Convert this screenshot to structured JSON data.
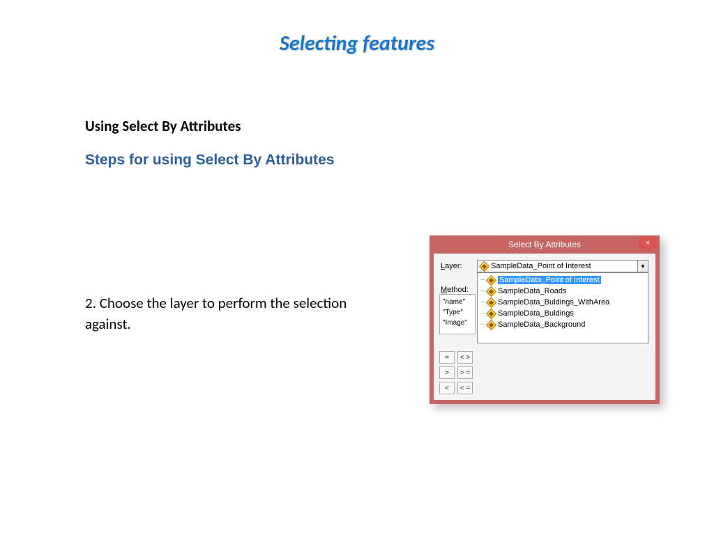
{
  "title": "Selecting features",
  "section1": "Using Select By Attributes",
  "section2": "Steps for using Select By Attributes",
  "step_text": "2. Choose the layer to perform the selection against.",
  "dialog": {
    "title": "Select By Attributes",
    "close_glyph": "×",
    "layer_label_pre": "L",
    "layer_label_rest": "ayer:",
    "method_label_pre": "M",
    "method_label_rest": "ethod:",
    "selected_layer": "SampleData_Point of Interest",
    "dropdown_arrow": "▼",
    "layers": [
      "SampleData_Point of Interest",
      "SampleData_Roads",
      "SampleData_Buldings_WithArea",
      "SampleData_Buldings",
      "SampleData_Background"
    ],
    "fields": [
      "\"name\"",
      "\"Type\"",
      "\"Image\""
    ],
    "ops": [
      [
        "=",
        "< >"
      ],
      [
        ">",
        "> ="
      ],
      [
        "<",
        "< ="
      ]
    ]
  }
}
